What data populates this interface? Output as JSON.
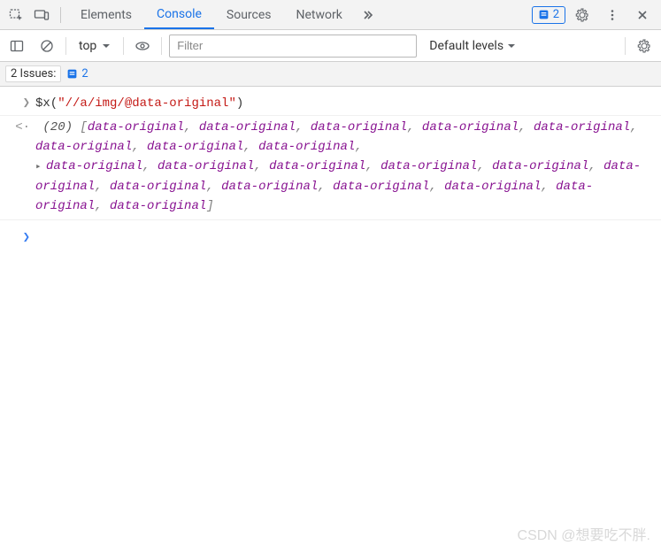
{
  "tabs": {
    "elements": "Elements",
    "console": "Console",
    "sources": "Sources",
    "network": "Network"
  },
  "toolbar": {
    "issues_count": "2",
    "context": "top",
    "filter_placeholder": "Filter",
    "levels": "Default levels"
  },
  "issuesbar": {
    "label": "2 Issues:",
    "count": "2"
  },
  "console": {
    "input": "$x(\"//a/img/@data-original\")",
    "output_len": "(20)",
    "items": [
      "data-original",
      "data-original",
      "data-original",
      "data-original",
      "data-original",
      "data-original",
      "data-original",
      "data-original",
      "data-original",
      "data-original",
      "data-original",
      "data-original",
      "data-original",
      "data-original",
      "data-original",
      "data-original",
      "data-original",
      "data-original",
      "data-original",
      "data-original"
    ]
  },
  "watermark": "CSDN @想要吃不胖."
}
